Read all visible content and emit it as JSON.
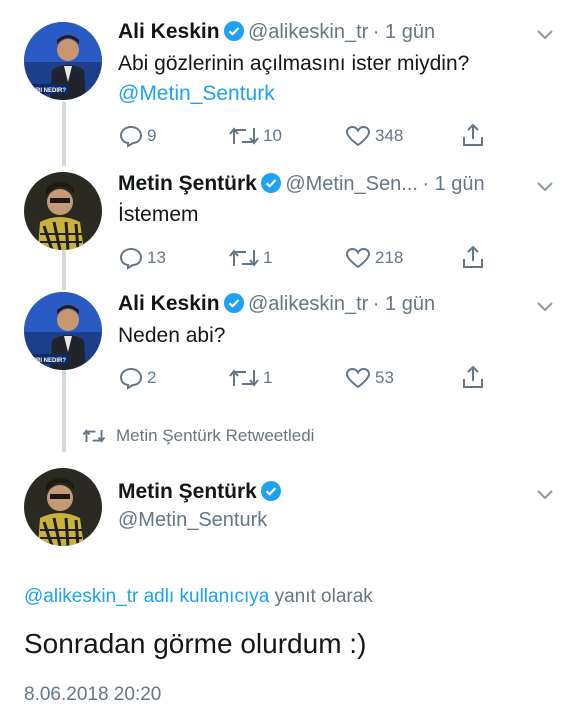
{
  "tweets": [
    {
      "author": "Ali Keskin",
      "handle": "@alikeskin_tr",
      "time": "· 1 gün",
      "text": "Abi gözlerinin açılmasını ister miydin?",
      "mention": "@Metin_Senturk",
      "replies": "9",
      "retweets": "10",
      "likes": "348",
      "avatar_label": "DIRI NEDIR?"
    },
    {
      "author": "Metin Şentürk",
      "handle": "@Metin_Sen...",
      "time": "· 1 gün",
      "text": "İstemem",
      "replies": "13",
      "retweets": "1",
      "likes": "218"
    },
    {
      "author": "Ali Keskin",
      "handle": "@alikeskin_tr",
      "time": "· 1 gün",
      "text": "Neden abi?",
      "replies": "2",
      "retweets": "1",
      "likes": "53",
      "avatar_label": "DIRI NEDIR?"
    }
  ],
  "retweet_notice": "Metin Şentürk Retweetledi",
  "main_tweet": {
    "author": "Metin Şentürk",
    "handle": "@Metin_Senturk",
    "reply_to_mention": "@alikeskin_tr adlı kullanıcıya",
    "reply_to_suffix": "yanıt olarak",
    "text": "Sonradan görme olurdum :)",
    "timestamp": "8.06.2018 20:20"
  },
  "colors": {
    "accent": "#1da1f2",
    "muted": "#657786",
    "line": "#cfd9de"
  }
}
